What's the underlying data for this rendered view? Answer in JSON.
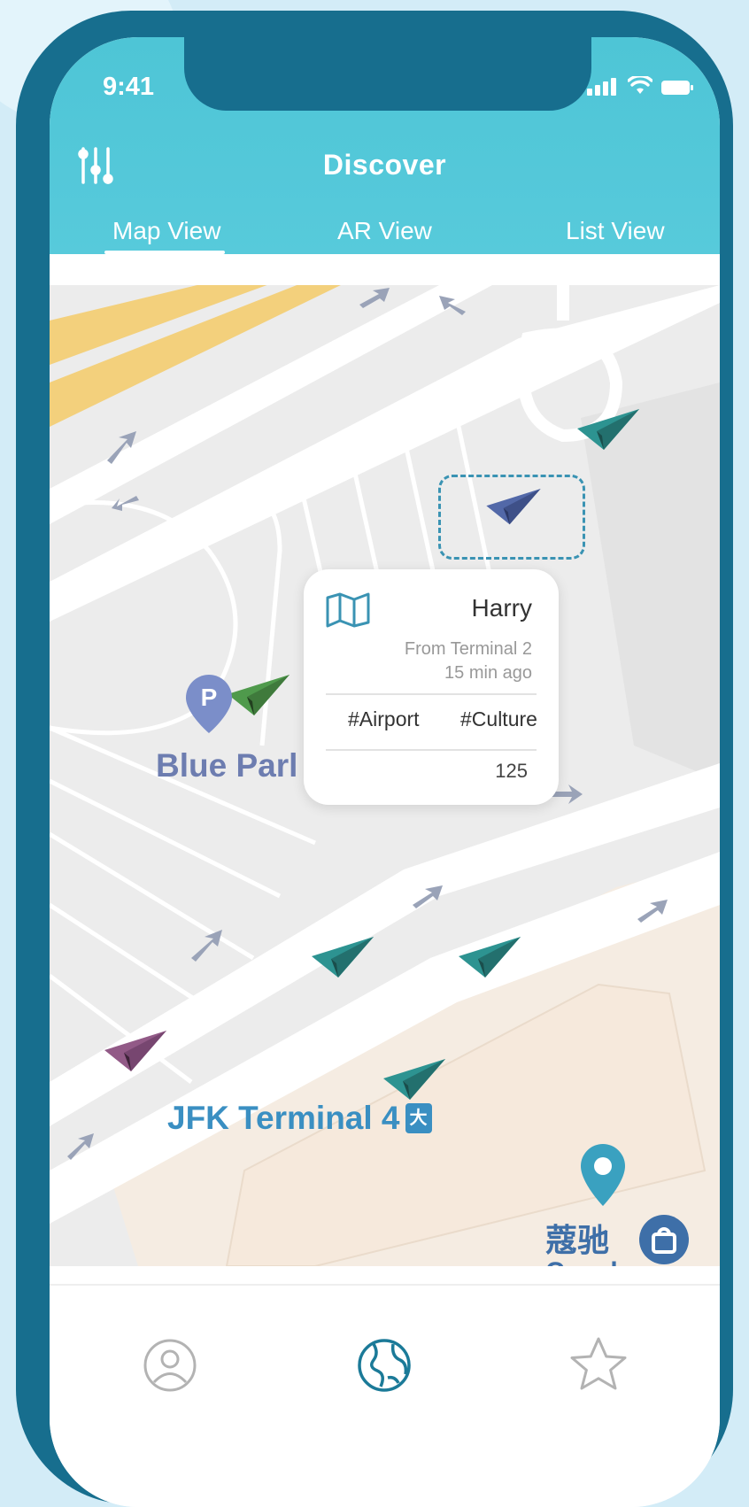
{
  "status_bar": {
    "time": "9:41"
  },
  "header": {
    "title": "Discover",
    "tabs": [
      {
        "label": "Map View",
        "active": true
      },
      {
        "label": "AR View",
        "active": false
      },
      {
        "label": "List View",
        "active": false
      }
    ]
  },
  "callout": {
    "icon": "map-icon",
    "author": "Harry",
    "origin": "From Terminal 2",
    "time_ago": "15 min ago",
    "tags": [
      "#Airport",
      "#Culture"
    ],
    "count": "125"
  },
  "map": {
    "labels": {
      "parking": "Blue Parl",
      "parking_icon": "P",
      "terminal": "JFK Terminal 4",
      "terminal_icon": "大",
      "store_cn": "蔻驰",
      "store_en": "Coach"
    },
    "colors": {
      "teal_plane": "#2d9391",
      "green_plane": "#4f9a4c",
      "blue_plane": "#5268a8",
      "purple_plane": "#925a87",
      "pin": "#3aa1c0"
    }
  },
  "bottom_nav": [
    "profile-icon",
    "globe-icon",
    "star-icon"
  ],
  "colors": {
    "accent": "#57cadb",
    "frame": "#176e8e"
  }
}
